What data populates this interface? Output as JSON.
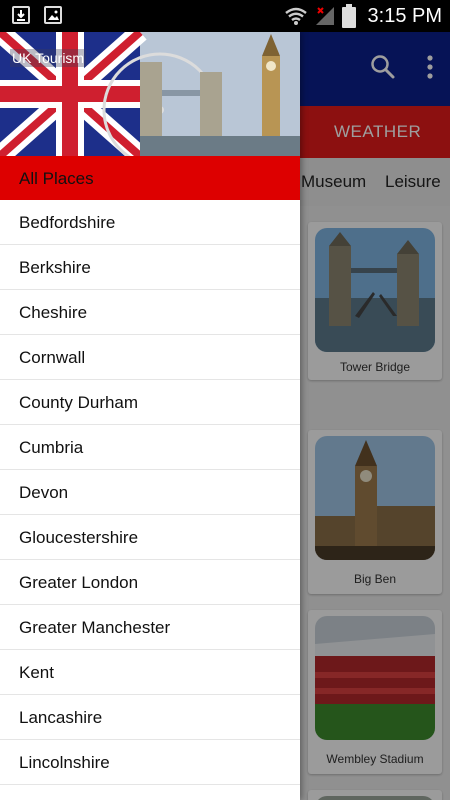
{
  "status_bar": {
    "time": "3:15 PM",
    "icons": [
      "download-icon",
      "image-icon",
      "wifi-icon",
      "signal-icon",
      "battery-icon"
    ]
  },
  "app_bar": {
    "actions": [
      "search-icon",
      "more-vert-icon"
    ],
    "background": "#0b1f8c"
  },
  "weather_bar": {
    "label": "WEATHER",
    "background": "#e31a1a"
  },
  "tabs": [
    {
      "label": "Museum"
    },
    {
      "label": "Leisure"
    }
  ],
  "cards": [
    {
      "caption": "Tower Bridge"
    },
    {
      "caption": "Big Ben"
    },
    {
      "caption": "Wembley Stadium"
    },
    {
      "caption": ""
    }
  ],
  "drawer": {
    "header_title": "UK Tourism",
    "active_color": "#dd0000",
    "items": [
      {
        "label": "All Places"
      },
      {
        "label": "Bedfordshire"
      },
      {
        "label": "Berkshire"
      },
      {
        "label": "Cheshire"
      },
      {
        "label": "Cornwall"
      },
      {
        "label": "County Durham"
      },
      {
        "label": "Cumbria"
      },
      {
        "label": "Devon"
      },
      {
        "label": "Gloucestershire"
      },
      {
        "label": "Greater London"
      },
      {
        "label": "Greater Manchester"
      },
      {
        "label": "Kent"
      },
      {
        "label": "Lancashire"
      },
      {
        "label": "Lincolnshire"
      }
    ]
  }
}
